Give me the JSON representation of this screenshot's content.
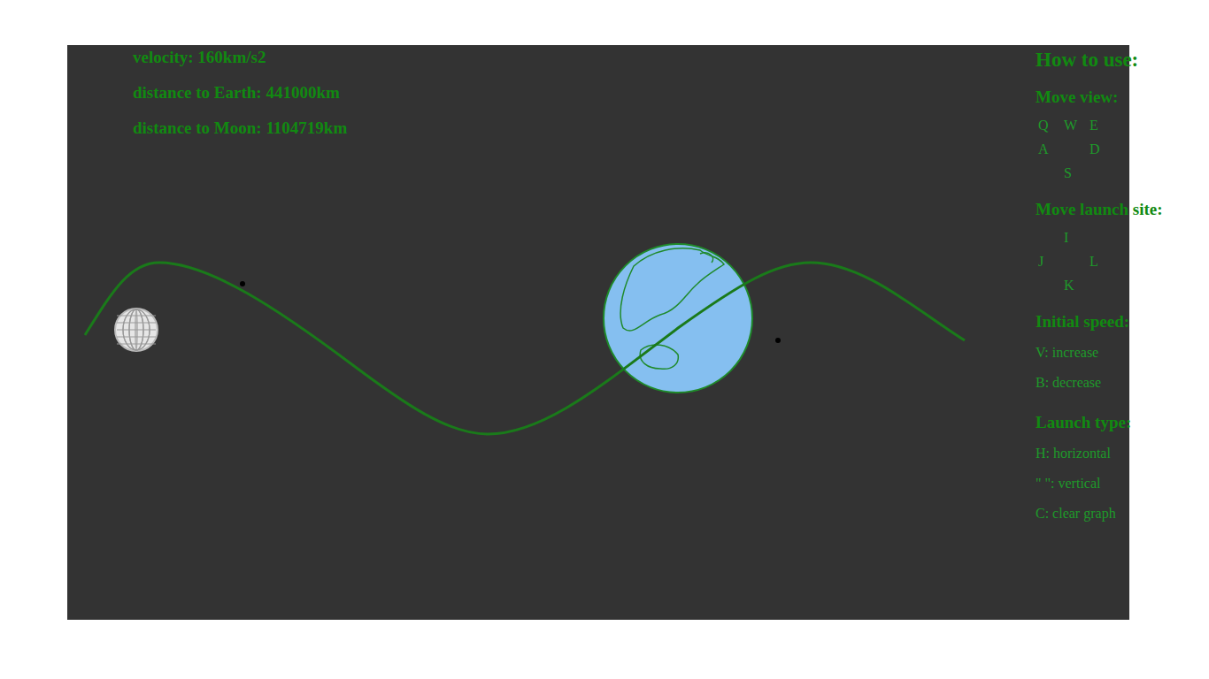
{
  "stats": [
    {
      "text": "velocity: 160km/s2"
    },
    {
      "text": "distance to Earth: 441000km"
    },
    {
      "text": "distance to Moon: 1104719km"
    }
  ],
  "help": {
    "title": "How to use:",
    "sections": [
      {
        "heading": "Move view:",
        "kind": "keys",
        "keys": [
          [
            "Q",
            "W",
            "E"
          ],
          [
            "A",
            "",
            "D"
          ],
          [
            "",
            "S",
            ""
          ]
        ]
      },
      {
        "heading": "Move launch site:",
        "kind": "keys",
        "keys": [
          [
            "",
            "I",
            ""
          ],
          [
            "J",
            "",
            "L"
          ],
          [
            "",
            "K",
            ""
          ]
        ]
      },
      {
        "heading": "Initial speed:",
        "kind": "lines",
        "lines": [
          "V: increase",
          "B: decrease"
        ]
      },
      {
        "heading": "Launch type:",
        "kind": "lines",
        "lines": [
          "H: horizontal",
          "\" \": vertical",
          "C: clear graph"
        ]
      }
    ]
  }
}
